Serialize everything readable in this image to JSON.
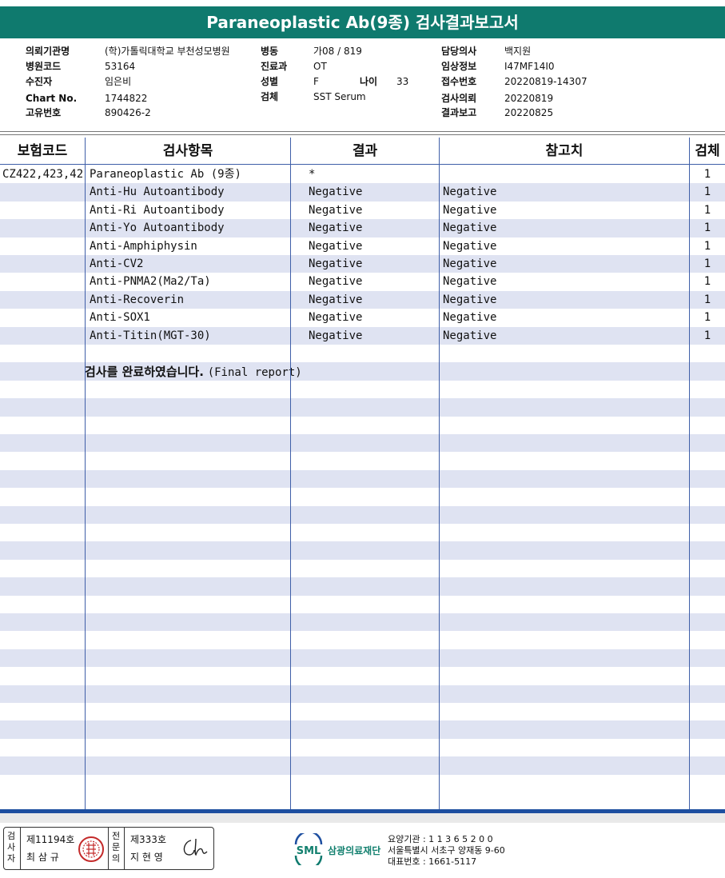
{
  "report": {
    "title": "Paraneoplastic Ab(9종) 검사결과보고서"
  },
  "patient_info": {
    "col1": [
      {
        "label": "의뢰기관명",
        "value": "(학)가톨릭대학교 부천성모병원"
      },
      {
        "label": "병원코드",
        "value": "53164"
      },
      {
        "label": "수진자",
        "value": "임은비"
      },
      {
        "label": "Chart No.",
        "value": "1744822"
      },
      {
        "label": "고유번호",
        "value": "890426-2"
      }
    ],
    "col2": [
      {
        "label": "병동",
        "value": "가08 / 819"
      },
      {
        "label": "진료과",
        "value": "OT"
      },
      {
        "label": "성별",
        "value": "F"
      },
      {
        "label": "검체",
        "value": "SST Serum"
      }
    ],
    "age": {
      "label": "나이",
      "value": "33"
    },
    "col3": [
      {
        "label": "담당의사",
        "value": "백지원"
      },
      {
        "label": "임상정보",
        "value": "I47MF14I0"
      },
      {
        "label": "접수번호",
        "value": "20220819-14307"
      },
      {
        "label": "검사의뢰",
        "value": "20220819"
      },
      {
        "label": "결과보고",
        "value": "20220825"
      }
    ]
  },
  "table": {
    "headers": [
      "보험코드",
      "검사항목",
      "결과",
      "참고치",
      "검체"
    ],
    "rows": [
      {
        "code": "CZ422,423,42",
        "item": "Paraneoplastic Ab (9종)",
        "result": "*",
        "reference": "",
        "specimen": "1"
      },
      {
        "code": "",
        "item": "Anti-Hu Autoantibody",
        "result": "Negative",
        "reference": "Negative",
        "specimen": "1"
      },
      {
        "code": "",
        "item": "Anti-Ri Autoantibody",
        "result": "Negative",
        "reference": "Negative",
        "specimen": "1"
      },
      {
        "code": "",
        "item": "Anti-Yo Autoantibody",
        "result": "Negative",
        "reference": "Negative",
        "specimen": "1"
      },
      {
        "code": "",
        "item": "Anti-Amphiphysin",
        "result": "Negative",
        "reference": "Negative",
        "specimen": "1"
      },
      {
        "code": "",
        "item": "Anti-CV2",
        "result": "Negative",
        "reference": "Negative",
        "specimen": "1"
      },
      {
        "code": "",
        "item": "Anti-PNMA2(Ma2/Ta)",
        "result": "Negative",
        "reference": "Negative",
        "specimen": "1"
      },
      {
        "code": "",
        "item": "Anti-Recoverin",
        "result": "Negative",
        "reference": "Negative",
        "specimen": "1"
      },
      {
        "code": "",
        "item": "Anti-SOX1",
        "result": "Negative",
        "reference": "Negative",
        "specimen": "1"
      },
      {
        "code": "",
        "item": "Anti-Titin(MGT-30)",
        "result": "Negative",
        "reference": "Negative",
        "specimen": "1"
      }
    ],
    "final_message_ko": "검사를  완료하였습니다.",
    "final_message_en": "(Final report)"
  },
  "footer": {
    "signer1": {
      "role": "검사자",
      "role_chars": [
        "검",
        "사",
        "자"
      ],
      "license": "제11194호",
      "name": "최 삼 규"
    },
    "signer2": {
      "role": "전문의",
      "role_chars": [
        "전",
        "문",
        "의"
      ],
      "license": "제333호",
      "name": "지 현 영"
    },
    "org_logo_text": "SML",
    "org_name": "삼광의료재단",
    "org_lines": [
      "요양기관 : 1 1 3 6 5 2 0 0",
      "서울특별시 서초구 양재동 9-60",
      "대표번호 : 1661-5117"
    ],
    "colors": {
      "brand_teal": "#0f7a6e",
      "table_blue": "#3f5fa8",
      "stripe": "#dfe3f2",
      "footer_blue": "#1e4fa0"
    }
  }
}
